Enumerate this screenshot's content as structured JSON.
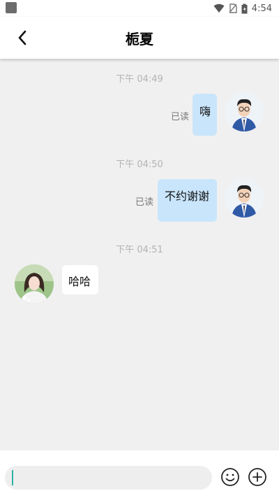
{
  "status_bar": {
    "time": "4:54"
  },
  "header": {
    "title": "栀夏"
  },
  "messages": [
    {
      "time": "下午 04:49",
      "text": "嗨",
      "status": "已读"
    },
    {
      "time": "下午 04:50",
      "text": "不约谢谢",
      "status": "已读"
    },
    {
      "time": "下午 04:51",
      "text": "哈哈"
    }
  ],
  "input": {
    "value": ""
  },
  "colors": {
    "accent": "#2bb3a3",
    "sent_bubble": "#c9e5fb",
    "received_bubble": "#ffffff",
    "background": "#f0f0f0"
  }
}
